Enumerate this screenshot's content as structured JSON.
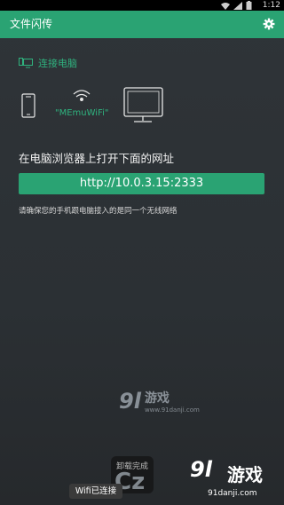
{
  "status_bar": {
    "time": "1:12"
  },
  "app_bar": {
    "title": "文件闪传",
    "settings_icon": "gear-icon"
  },
  "connect_section": {
    "label": "连接电脑",
    "icon": "devices-icon"
  },
  "diagram": {
    "wifi_name": "\"MEmuWiFi\"",
    "phone_icon": "phone-icon",
    "wifi_icon": "wifi-icon",
    "monitor_icon": "monitor-icon"
  },
  "instruction": "在电脑浏览器上打开下面的网址",
  "url_button": "http://10.0.3.15:2333",
  "note": "请确保您的手机跟电脑接入的是同一个无线网络",
  "watermark_center": {
    "logo": "9l",
    "name": "游戏",
    "domain": "www.91danji.com"
  },
  "uninstall_toast": "卸载完成",
  "toast": "Wifi已连接",
  "watermark_corner": {
    "logo": "9l",
    "name": "游戏",
    "domain": "91danji.com"
  },
  "colors": {
    "accent": "#2aa373",
    "accent_text": "#2fb27e",
    "background": "#2f3438"
  }
}
